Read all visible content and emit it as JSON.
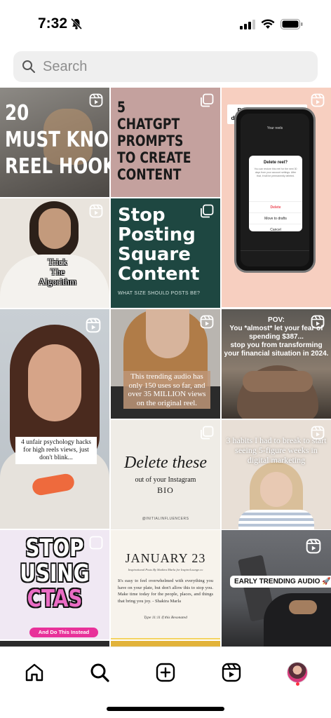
{
  "status": {
    "time": "7:32"
  },
  "search": {
    "placeholder": "Search"
  },
  "tiles": {
    "t1": {
      "line1": "20",
      "line2": "MUST KNOW",
      "line3": "REEL HOOKS."
    },
    "t2": {
      "line1": "5",
      "line2": "CHATGPT",
      "line3": "PROMPTS",
      "line4": "TO CREATE",
      "line5": "CONTENT"
    },
    "t3": {
      "caption": "But instead of hitting delete tap move to drafts.",
      "screen_title": "Your reels",
      "dialog_title": "Delete reel?",
      "dialog_body": "You can restore this reel for the next 30 days from your account settings. After that, it will be permanently deleted.",
      "option_delete": "Delete",
      "option_drafts": "Move to drafts",
      "option_cancel": "Cancel"
    },
    "t4": {
      "line1": "Trick",
      "line2": "The",
      "line3": "Algorithm"
    },
    "t5": {
      "line1": "Stop",
      "line2": "Posting",
      "line3": "Square",
      "line4": "Content",
      "sub": "WHAT SIZE SHOULD POSTS BE?"
    },
    "t6": {
      "caption": "4 unfair psychology hacks for high reels views, just don't blink..."
    },
    "t7": {
      "caption": "This trending audio has only 150 uses so far, and over 35 MILLION views on the original reel."
    },
    "t8": {
      "line1": "POV:",
      "line2": "You *almost* let your fear of",
      "line3": "spending $387...",
      "line4": "stop you from transforming",
      "line5": "your financial situation in 2024."
    },
    "t9": {
      "line1": "Delete these",
      "line2": "out of your Instagram",
      "line3": "BIO",
      "handle": "@INITIALINFLUENCERS"
    },
    "t10": {
      "caption": "3 habits I had to break to start seeing 5-figure weeks in digital marketing"
    },
    "t11": {
      "line1": "STOP",
      "line2": "USING",
      "line3": "CTAS",
      "button": "And Do This Instead"
    },
    "t12": {
      "title": "JANUARY 23",
      "sub": "Inspirational Posts By Shakira Marla for InspireLounge.co",
      "body": "It's easy to feel overwhelmed with everything you have on your plate, but don't allow this to stop you. Make time today for the people, places, and things that bring you joy. - Shakira Marla",
      "footer": "Type 11:11 if this Resonated"
    },
    "t13": {
      "label": "EARLY TRENDING AUDIO 🚀"
    }
  },
  "colors": {
    "tab_active": "#000000",
    "notif_dot": "#ff3040",
    "search_bg": "#efefef"
  }
}
